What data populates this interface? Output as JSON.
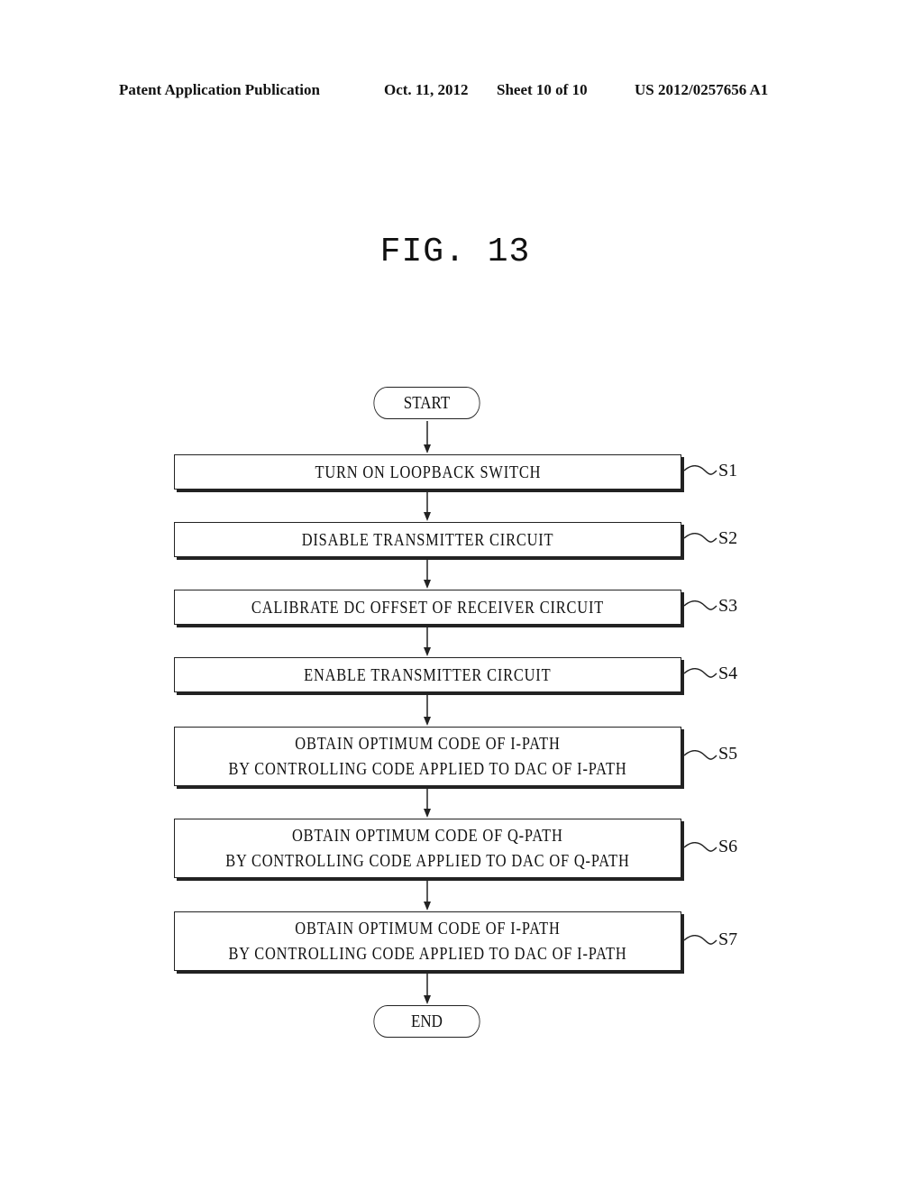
{
  "header": {
    "publication": "Patent Application Publication",
    "date": "Oct. 11, 2012",
    "sheet": "Sheet 10 of 10",
    "number": "US 2012/0257656 A1"
  },
  "figure": {
    "title": "FIG. 13",
    "start": "START",
    "end": "END",
    "steps": [
      {
        "label": "S1",
        "lines": [
          "TURN ON LOOPBACK SWITCH"
        ]
      },
      {
        "label": "S2",
        "lines": [
          "DISABLE TRANSMITTER CIRCUIT"
        ]
      },
      {
        "label": "S3",
        "lines": [
          "CALIBRATE DC OFFSET OF RECEIVER CIRCUIT"
        ]
      },
      {
        "label": "S4",
        "lines": [
          "ENABLE TRANSMITTER CIRCUIT"
        ]
      },
      {
        "label": "S5",
        "lines": [
          "OBTAIN OPTIMUM CODE OF I-PATH",
          "BY CONTROLLING CODE APPLIED TO DAC OF I-PATH"
        ]
      },
      {
        "label": "S6",
        "lines": [
          "OBTAIN OPTIMUM CODE OF Q-PATH",
          "BY CONTROLLING CODE APPLIED TO DAC OF Q-PATH"
        ]
      },
      {
        "label": "S7",
        "lines": [
          "OBTAIN OPTIMUM CODE OF I-PATH",
          "BY CONTROLLING CODE APPLIED TO DAC OF I-PATH"
        ]
      }
    ]
  }
}
